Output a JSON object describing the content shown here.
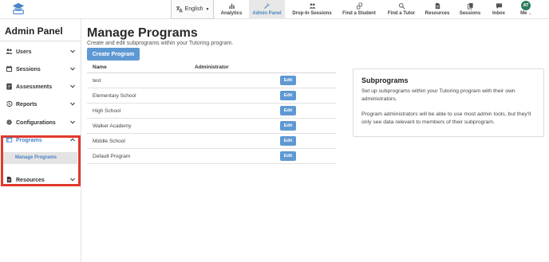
{
  "header": {
    "language": "English",
    "nav": [
      {
        "label": "Analytics",
        "icon": "bar-chart-icon",
        "active": false
      },
      {
        "label": "Admin Panel",
        "icon": "wrench-icon",
        "active": true
      },
      {
        "label": "Drop-In Sessions",
        "icon": "people-icon",
        "active": false
      },
      {
        "label": "Find a Student",
        "icon": "share-icon",
        "active": false
      },
      {
        "label": "Find a Tutor",
        "icon": "search-icon",
        "active": false
      },
      {
        "label": "Resources",
        "icon": "document-icon",
        "active": false
      },
      {
        "label": "Sessions",
        "icon": "copy-icon",
        "active": false
      },
      {
        "label": "Inbox",
        "icon": "chat-icon",
        "active": false
      }
    ],
    "user": {
      "initials": "AT",
      "menu_label": "Me"
    }
  },
  "sidebar": {
    "title": "Admin Panel",
    "items": [
      {
        "label": "Users",
        "icon": "users-icon"
      },
      {
        "label": "Sessions",
        "icon": "calendar-icon"
      },
      {
        "label": "Assessments",
        "icon": "clipboard-icon"
      },
      {
        "label": "Reports",
        "icon": "history-icon"
      },
      {
        "label": "Configurations",
        "icon": "gear-icon"
      },
      {
        "label": "Programs",
        "icon": "window-icon",
        "expanded": true,
        "subitems": [
          {
            "label": "Manage Programs",
            "selected": true
          }
        ]
      },
      {
        "label": "Resources",
        "icon": "document-icon"
      }
    ]
  },
  "main": {
    "title": "Manage Programs",
    "subtitle": "Create and edit subprograms within your Tutoring program.",
    "create_button": "Create Program",
    "table": {
      "columns": [
        "Name",
        "Administrator"
      ],
      "edit_label": "Edit",
      "rows": [
        {
          "name": "test",
          "administrator": ""
        },
        {
          "name": "Elementary School",
          "administrator": ""
        },
        {
          "name": "High School",
          "administrator": ""
        },
        {
          "name": "Walker Academy",
          "administrator": ""
        },
        {
          "name": "Middle School",
          "administrator": ""
        },
        {
          "name": "Default Program",
          "administrator": ""
        }
      ]
    },
    "info_card": {
      "title": "Subprograms",
      "paragraph1": "Set up subprograms within your Tutoring program with their own administrators.",
      "paragraph2": "Program administrators will be able to use most admin tools, but they'll only see data relevant to members of their subprogram."
    }
  },
  "colors": {
    "accent": "#5f99d3",
    "highlight": "#e23a2c",
    "avatar": "#2e7d5b"
  }
}
